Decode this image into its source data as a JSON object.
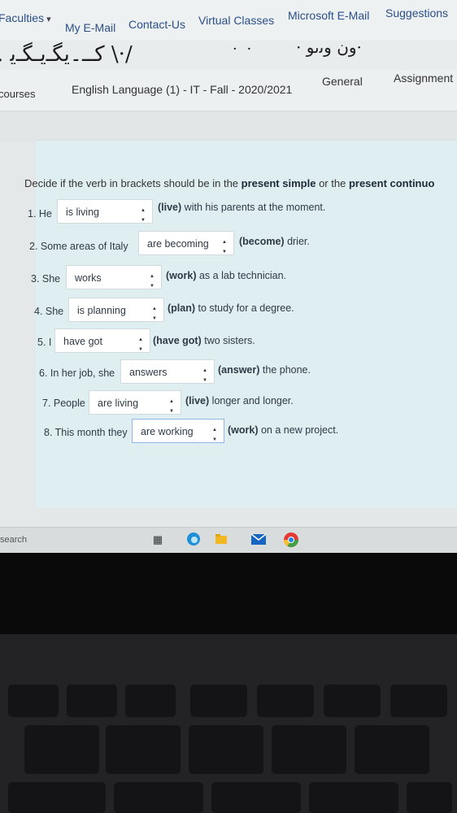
{
  "nav": {
    "items": [
      "Faculties",
      "My E-Mail",
      "Contact-Us",
      "Virtual Classes",
      "Microsoft E-Mail",
      "Suggestions"
    ]
  },
  "courses": {
    "crumb": "courses",
    "course_title": "English Language (1) - IT - Fall - 2020/2021",
    "tab_general": "General",
    "tab_assignment": "Assignment"
  },
  "quiz": {
    "instruction_pre": "Decide if the verb in brackets should be in the",
    "instruction_b1": "present simple",
    "instruction_mid": "or the",
    "instruction_b2": "present continuo",
    "questions": [
      {
        "prefix": "1. He",
        "answer": "is living",
        "hint": "(live)",
        "rest": "with his parents at the moment."
      },
      {
        "prefix": "2. Some areas of Italy",
        "answer": "are becoming",
        "hint": "(become)",
        "rest": "drier."
      },
      {
        "prefix": "3. She",
        "answer": "works",
        "hint": "(work)",
        "rest": "as a lab technician."
      },
      {
        "prefix": "4. She",
        "answer": "is planning",
        "hint": "(plan)",
        "rest": "to study for a degree."
      },
      {
        "prefix": "5. I",
        "answer": "have got",
        "hint": "(have got)",
        "rest": "two sisters."
      },
      {
        "prefix": "6. In her job, she",
        "answer": "answers",
        "hint": "(answer)",
        "rest": "the phone."
      },
      {
        "prefix": "7. People",
        "answer": "are living",
        "hint": "(live)",
        "rest": "longer and longer."
      },
      {
        "prefix": "8. This month they",
        "answer": "are working",
        "hint": "(work)",
        "rest": "on a new project."
      }
    ]
  },
  "taskbar": {
    "search": "search",
    "icons": [
      "task-view-icon",
      "edge-icon",
      "file-explorer-icon",
      "mail-icon",
      "chrome-icon"
    ]
  }
}
